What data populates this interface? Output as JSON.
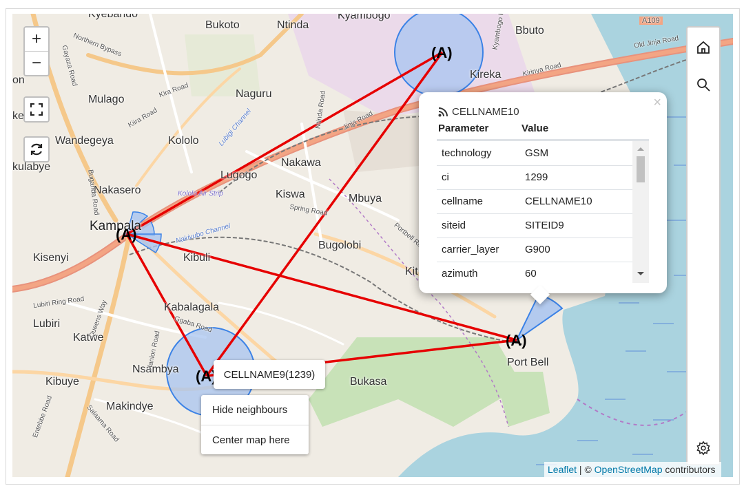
{
  "map": {
    "places": [
      {
        "name": "Bukoto"
      },
      {
        "name": "Ntinda"
      },
      {
        "name": "Kyambogo"
      },
      {
        "name": "Bbuto"
      },
      {
        "name": "Naguru"
      },
      {
        "name": "Mulago"
      },
      {
        "name": "Kololo"
      },
      {
        "name": "Wandegeya"
      },
      {
        "name": "Nakawa"
      },
      {
        "name": "Lugogo"
      },
      {
        "name": "Kiswa"
      },
      {
        "name": "Mbuya"
      },
      {
        "name": "Nakasero"
      },
      {
        "name": "Kampala"
      },
      {
        "name": "Bugolobi"
      },
      {
        "name": "Kisenyi"
      },
      {
        "name": "Kibuli"
      },
      {
        "name": "Kabalagala"
      },
      {
        "name": "Lubiri"
      },
      {
        "name": "Katwe"
      },
      {
        "name": "Nsambya"
      },
      {
        "name": "Kibuye"
      },
      {
        "name": "Makindye"
      },
      {
        "name": "Bukasa"
      },
      {
        "name": "Port Bell"
      },
      {
        "name": "Kireka"
      },
      {
        "name": "Kit"
      },
      {
        "name": "Kyebando"
      },
      {
        "name": "kulabye"
      },
      {
        "name": "ke"
      },
      {
        "name": "on"
      }
    ],
    "roads": [
      {
        "name": "Northern Bypass"
      },
      {
        "name": "Gayaza Road"
      },
      {
        "name": "Kira Road"
      },
      {
        "name": "Kiira Road"
      },
      {
        "name": "Jinja Road"
      },
      {
        "name": "Spring Road"
      },
      {
        "name": "Portbell Road"
      },
      {
        "name": "Buganda Road"
      },
      {
        "name": "Queens Way"
      },
      {
        "name": "Lubiri Ring Road"
      },
      {
        "name": "Ggaba Road"
      },
      {
        "name": "Hanlon Road"
      },
      {
        "name": "Entebbe Road"
      },
      {
        "name": "Salaama Road"
      },
      {
        "name": "Old Jinja Road"
      },
      {
        "name": "Kirinya Road"
      },
      {
        "name": "A109"
      },
      {
        "name": "Kololo Air Strip"
      },
      {
        "name": "Nakivubo Channel"
      },
      {
        "name": "Lubigi Channel"
      },
      {
        "name": "Ntinda Road"
      },
      {
        "name": "Kyambogo Road"
      }
    ],
    "cell_marker_glyph": "(A)"
  },
  "controls": {
    "zoom_in_label": "+",
    "zoom_out_label": "−",
    "fullscreen_icon": "fullscreen-icon",
    "refresh_icon": "refresh-icon"
  },
  "sidebar": {
    "home_icon": "home-icon",
    "search_icon": "search-icon",
    "settings_icon": "gear-icon"
  },
  "popup": {
    "title": "CELLNAME10",
    "close_label": "×",
    "col_parameter": "Parameter",
    "col_value": "Value",
    "rows": [
      {
        "param": "technology",
        "value": "GSM"
      },
      {
        "param": "ci",
        "value": "1299"
      },
      {
        "param": "cellname",
        "value": "CELLNAME10"
      },
      {
        "param": "siteid",
        "value": "SITEID9"
      },
      {
        "param": "carrier_layer",
        "value": "G900"
      },
      {
        "param": "azimuth",
        "value": "60"
      }
    ]
  },
  "cell_label": "CELLNAME9(1239)",
  "context_menu": {
    "hide_neighbours": "Hide neighbours",
    "center_map": "Center map here"
  },
  "attribution": {
    "leaflet": "Leaflet",
    "separator": " | © ",
    "osm": "OpenStreetMap",
    "suffix": " contributors"
  },
  "colors": {
    "neighbour_line": "#e60000",
    "cell_fill": "#a8c4f0",
    "cell_stroke": "#3b82e6",
    "link": "#0078a8"
  }
}
